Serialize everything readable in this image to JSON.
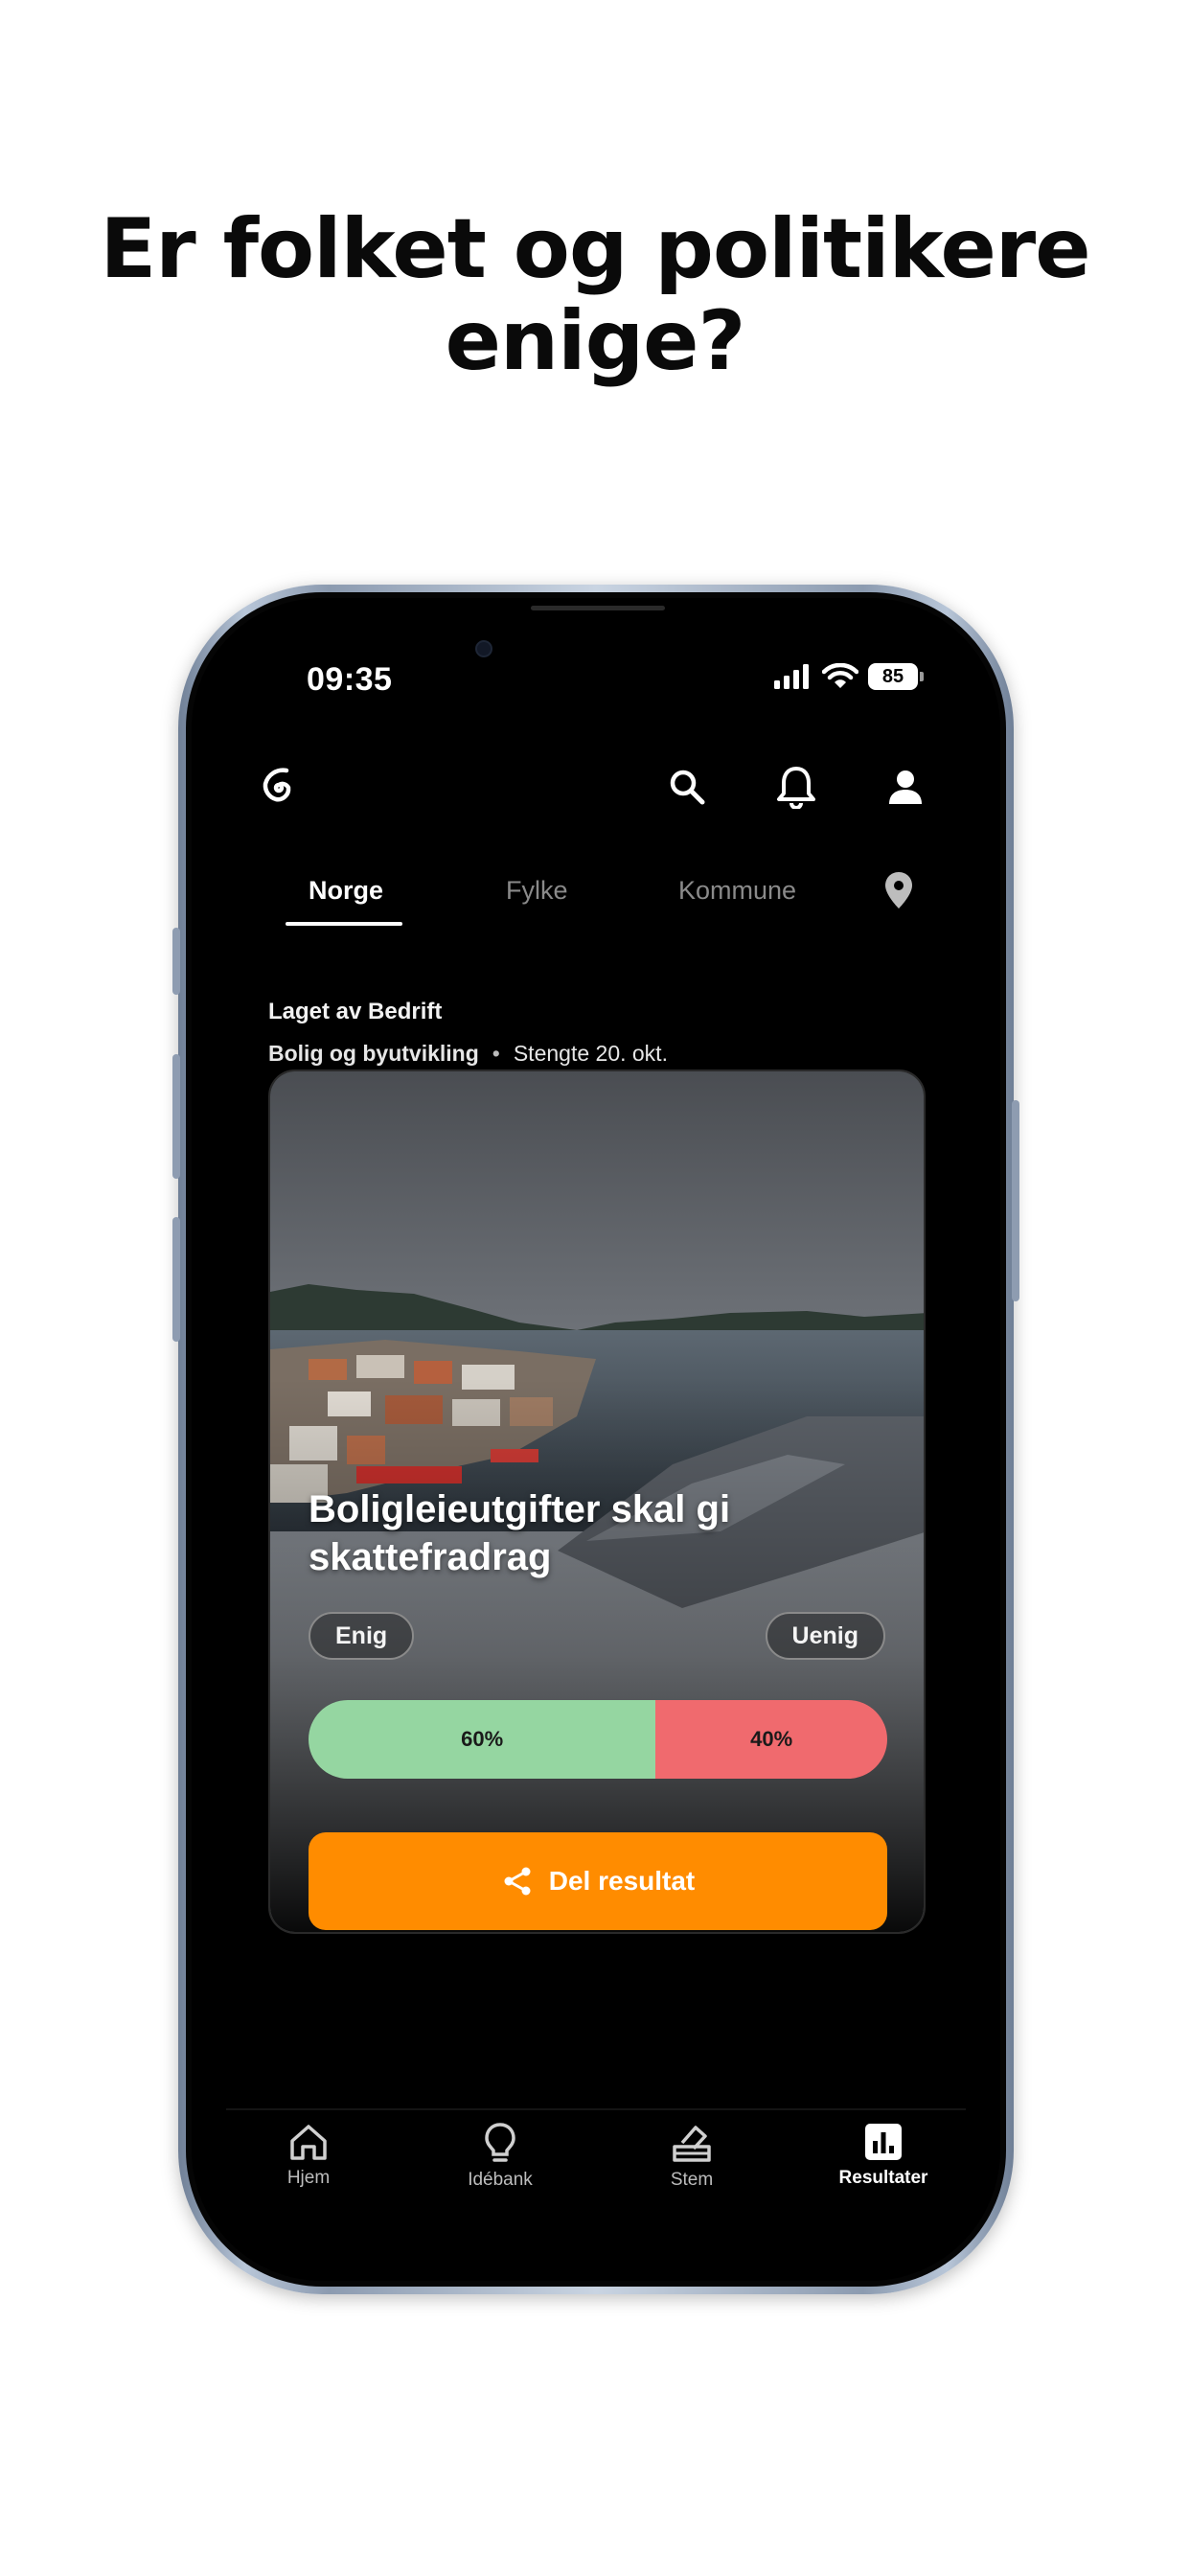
{
  "headline": {
    "line1": "Er folket og politikere",
    "line2": "enige?"
  },
  "status_bar": {
    "time": "09:35",
    "battery": "85"
  },
  "top_bar": {
    "logo_icon": "spiral-logo-icon",
    "icons": [
      "search-icon",
      "bell-icon",
      "user-icon"
    ]
  },
  "tabs": [
    {
      "label": "Norge",
      "active": true
    },
    {
      "label": "Fylke",
      "active": false
    },
    {
      "label": "Kommune",
      "active": false
    }
  ],
  "location_icon": "location-pin-icon",
  "poll": {
    "creator": "Laget av Bedrift",
    "category": "Bolig og byutvikling",
    "separator": "•",
    "closed": "Stengte 20. okt.",
    "title": "Boligleieutgifter skal gi skattefradrag",
    "agree_label": "Enig",
    "disagree_label": "Uenig",
    "agree_percent": 60,
    "disagree_percent": 40,
    "agree_text": "60%",
    "disagree_text": "40%",
    "agree_color": "#95d6a1",
    "disagree_color": "#f06a6e",
    "share_label": "Del resultat",
    "share_color": "#ff8c00"
  },
  "bottom_nav": [
    {
      "label": "Hjem",
      "icon": "home-icon",
      "active": false
    },
    {
      "label": "Idébank",
      "icon": "lightbulb-icon",
      "active": false
    },
    {
      "label": "Stem",
      "icon": "ballot-box-icon",
      "active": false
    },
    {
      "label": "Resultater",
      "icon": "bar-chart-icon",
      "active": true
    }
  ]
}
